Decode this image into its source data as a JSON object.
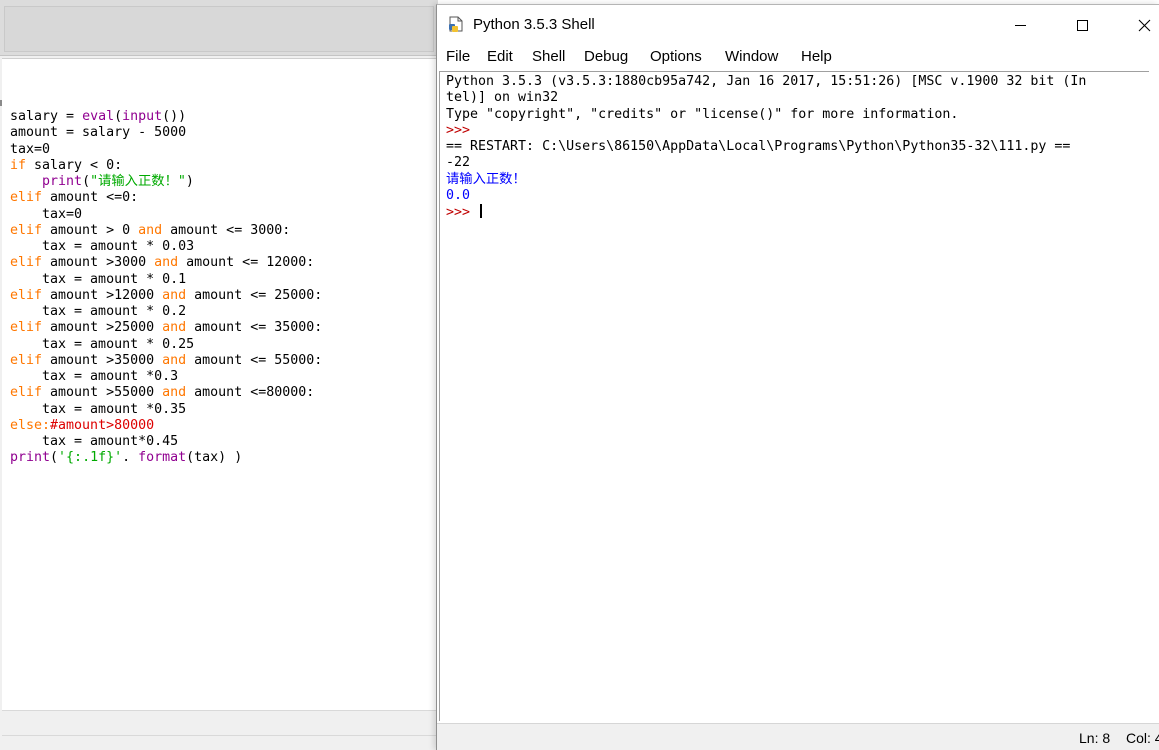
{
  "editor": {
    "code_lines": [
      [
        {
          "t": "salary = "
        },
        {
          "t": "eval",
          "c": "bi"
        },
        {
          "t": "("
        },
        {
          "t": "input",
          "c": "bi"
        },
        {
          "t": "())"
        }
      ],
      [
        {
          "t": "amount = salary - 5000"
        }
      ],
      [
        {
          "t": "tax=0"
        }
      ],
      [
        {
          "t": "if",
          "c": "kw"
        },
        {
          "t": " salary < 0:"
        }
      ],
      [
        {
          "t": "    "
        },
        {
          "t": "print",
          "c": "bi"
        },
        {
          "t": "("
        },
        {
          "t": "\"请输入正数！\"",
          "c": "st"
        },
        {
          "t": ")"
        }
      ],
      [
        {
          "t": "elif",
          "c": "kw"
        },
        {
          "t": " amount <=0:"
        }
      ],
      [
        {
          "t": "    tax=0"
        }
      ],
      [
        {
          "t": "elif",
          "c": "kw"
        },
        {
          "t": " amount > 0 "
        },
        {
          "t": "and",
          "c": "kw"
        },
        {
          "t": " amount <= 3000:"
        }
      ],
      [
        {
          "t": "    tax = amount * 0.03"
        }
      ],
      [
        {
          "t": "elif",
          "c": "kw"
        },
        {
          "t": " amount >3000 "
        },
        {
          "t": "and",
          "c": "kw"
        },
        {
          "t": " amount <= 12000:"
        }
      ],
      [
        {
          "t": "    tax = amount * 0.1"
        }
      ],
      [
        {
          "t": "elif",
          "c": "kw"
        },
        {
          "t": " amount >12000 "
        },
        {
          "t": "and",
          "c": "kw"
        },
        {
          "t": " amount <= 25000:"
        }
      ],
      [
        {
          "t": "    tax = amount * 0.2"
        }
      ],
      [
        {
          "t": "elif",
          "c": "kw"
        },
        {
          "t": " amount >25000 "
        },
        {
          "t": "and",
          "c": "kw"
        },
        {
          "t": " amount <= 35000:"
        }
      ],
      [
        {
          "t": "    tax = amount * 0.25"
        }
      ],
      [
        {
          "t": "elif",
          "c": "kw"
        },
        {
          "t": " amount >35000 "
        },
        {
          "t": "and",
          "c": "kw"
        },
        {
          "t": " amount <= 55000:"
        }
      ],
      [
        {
          "t": "    tax = amount *0.3"
        }
      ],
      [
        {
          "t": "elif",
          "c": "kw"
        },
        {
          "t": " amount >55000 "
        },
        {
          "t": "and",
          "c": "kw"
        },
        {
          "t": " amount <=80000:"
        }
      ],
      [
        {
          "t": "    tax = amount *0.35"
        }
      ],
      [
        {
          "t": "else:",
          "c": "kw"
        },
        {
          "t": "#amount>80000",
          "c": "cm"
        }
      ],
      [
        {
          "t": "    tax = amount*0.45"
        }
      ],
      [
        {
          "t": "print",
          "c": "bi"
        },
        {
          "t": "("
        },
        {
          "t": "'{:.1f}'",
          "c": "st"
        },
        {
          "t": ". "
        },
        {
          "t": "format",
          "c": "bi"
        },
        {
          "t": "(tax) )"
        }
      ]
    ]
  },
  "shell": {
    "title": "Python 3.5.3 Shell",
    "menu": [
      "File",
      "Edit",
      "Shell",
      "Debug",
      "Options",
      "Window",
      "Help"
    ],
    "output_lines": [
      [
        {
          "t": "Python 3.5.3 (v3.5.3:1880cb95a742, Jan 16 2017, 15:51:26) [MSC v.1900 32 bit (In"
        }
      ],
      [
        {
          "t": "tel)] on win32"
        }
      ],
      [
        {
          "t": "Type \"copyright\", \"credits\" or \"license()\" for more information."
        }
      ],
      [
        {
          "t": ">>> ",
          "c": "pr"
        }
      ],
      [
        {
          "t": "== RESTART: C:\\Users\\86150\\AppData\\Local\\Programs\\Python\\Python35-32\\111.py =="
        }
      ],
      [
        {
          "t": "-22"
        }
      ],
      [
        {
          "t": "请输入正数！",
          "c": "op"
        }
      ],
      [
        {
          "t": "0.0",
          "c": "op"
        }
      ],
      [
        {
          "t": ">>> ",
          "c": "pr"
        },
        {
          "cursor": true
        }
      ]
    ],
    "status": {
      "ln": "Ln: 8",
      "col": "Col: 4"
    }
  },
  "colors": {
    "keyword": "#ff7700",
    "builtin": "#900090",
    "string": "#00aa00",
    "comment": "#dd0000",
    "prompt": "#c00000",
    "output": "#0000ff"
  },
  "icons": {
    "app": "python-idle-icon",
    "minimize": "minimize-icon",
    "maximize": "maximize-icon",
    "close": "close-icon"
  }
}
